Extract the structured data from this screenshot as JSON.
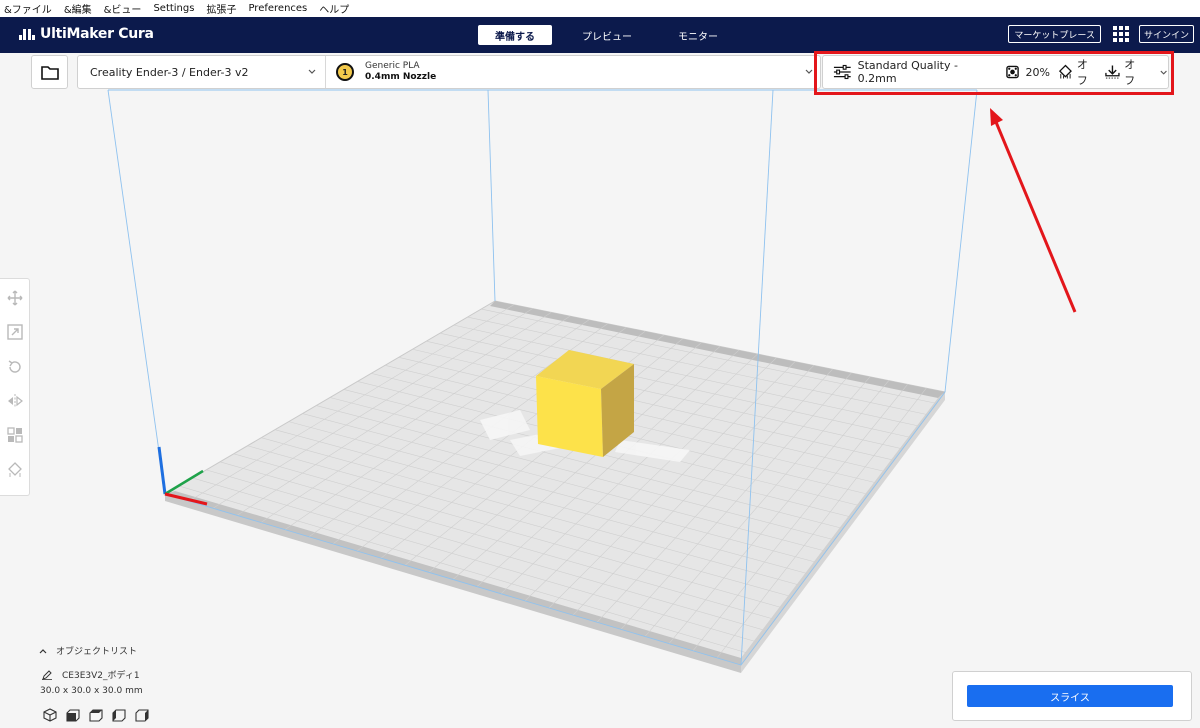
{
  "menu": [
    "&ファイル",
    "&編集",
    "&ビュー",
    "Settings",
    "拡張子",
    "Preferences",
    "ヘルプ"
  ],
  "header": {
    "app_name": "UltiMaker Cura",
    "stages": [
      "準備する",
      "プレビュー",
      "モニター"
    ],
    "active_stage": 0,
    "marketplace_label": "マーケットプレース",
    "signin_label": "サインイン"
  },
  "printer": {
    "name": "Creality Ender-3 / Ender-3 v2",
    "extruder_number": "1",
    "material": "Generic PLA",
    "nozzle": "0.4mm Nozzle"
  },
  "print_settings": {
    "profile": "Standard Quality - 0.2mm",
    "infill": "20%",
    "support": "オフ",
    "adhesion": "オフ"
  },
  "object_list": {
    "header": "オブジェクトリスト",
    "object_name": "CE3E3V2_ボディ1",
    "dimensions": "30.0 x 30.0 x 30.0 mm"
  },
  "slice_label": "スライス",
  "colors": {
    "header_bg": "#0c1a4c",
    "accent": "#196ef0",
    "model": "#fde24a",
    "highlight": "#e3161b"
  }
}
